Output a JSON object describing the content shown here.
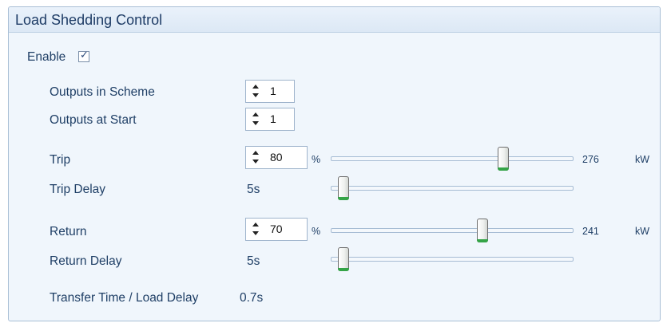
{
  "panel": {
    "title": "Load Shedding Control"
  },
  "enable": {
    "label": "Enable",
    "checked": true
  },
  "outputs_in_scheme": {
    "label": "Outputs in Scheme",
    "value": "1"
  },
  "outputs_at_start": {
    "label": "Outputs at Start",
    "value": "1"
  },
  "trip": {
    "label": "Trip",
    "value": "80",
    "unit": "%",
    "level": 0.72,
    "kw_value": "276",
    "kw_unit": "kW"
  },
  "trip_delay": {
    "label": "Trip Delay",
    "value": "5s",
    "level": 0.03
  },
  "return": {
    "label": "Return",
    "value": "70",
    "unit": "%",
    "level": 0.63,
    "kw_value": "241",
    "kw_unit": "kW"
  },
  "return_delay": {
    "label": "Return Delay",
    "value": "5s",
    "level": 0.03
  },
  "transfer": {
    "label": "Transfer Time / Load Delay",
    "value": "0.7s"
  },
  "colors": {
    "title_text": "#1e3c66",
    "panel_bg": "#f0f6fc",
    "slider_thumb_accent": "#35a447"
  }
}
